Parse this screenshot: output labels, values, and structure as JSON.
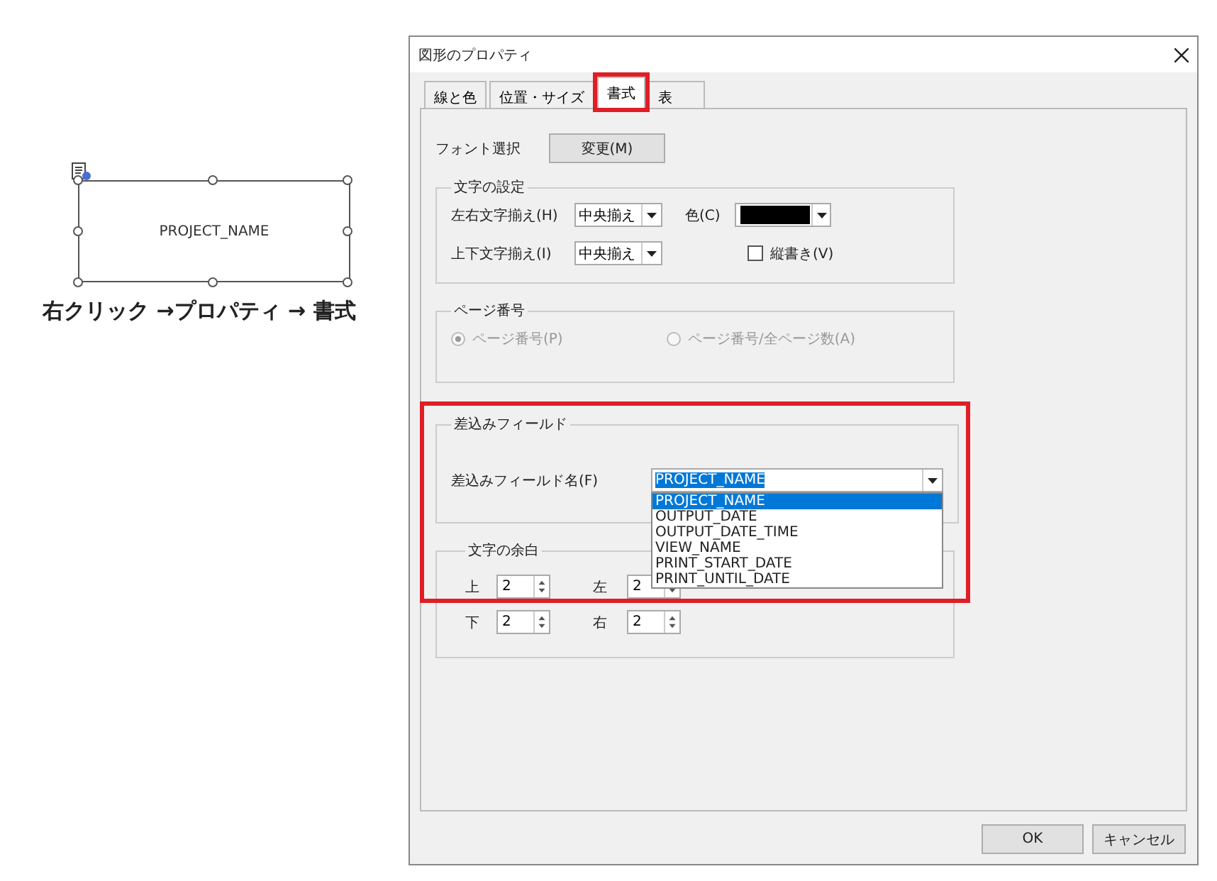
{
  "annotation": {
    "shape_text": "PROJECT_NAME",
    "caption": "右クリック →プロパティ → 書式"
  },
  "dialog": {
    "title": "図形のプロパティ",
    "tabs": [
      {
        "label": "線と色",
        "selected": false,
        "highlighted": false
      },
      {
        "label": "位置・サイズ",
        "selected": false,
        "highlighted": false
      },
      {
        "label": "書式",
        "selected": true,
        "highlighted": true
      },
      {
        "label": "表",
        "selected": false,
        "highlighted": false
      }
    ],
    "font": {
      "label": "フォント選択",
      "button": "変更(M)"
    },
    "text_settings": {
      "title": "文字の設定",
      "h_align": {
        "label": "左右文字揃え(H)",
        "value": "中央揃え"
      },
      "v_align": {
        "label": "上下文字揃え(I)",
        "value": "中央揃え"
      },
      "color": {
        "label": "色(C)",
        "color": "#000000"
      },
      "vertical": {
        "label": "縦書き(V)",
        "checked": false
      }
    },
    "page_number": {
      "title": "ページ番号",
      "disabled": true,
      "options": [
        {
          "label": "ページ番号(P)",
          "selected": true
        },
        {
          "label": "ページ番号/全ページ数(A)",
          "selected": false
        }
      ]
    },
    "merge_field": {
      "title": "差込みフィールド",
      "highlighted": true,
      "label": "差込みフィールド名(F)",
      "value": "PROJECT_NAME",
      "expanded": true,
      "options": [
        {
          "label": "PROJECT_NAME",
          "selected": true
        },
        {
          "label": "OUTPUT_DATE",
          "selected": false
        },
        {
          "label": "OUTPUT_DATE_TIME",
          "selected": false
        },
        {
          "label": "VIEW_NAME",
          "selected": false
        },
        {
          "label": "PRINT_START_DATE",
          "selected": false
        },
        {
          "label": "PRINT_UNTIL_DATE",
          "selected": false
        }
      ]
    },
    "margins": {
      "title": "文字の余白",
      "fields": [
        {
          "label": "上",
          "value": "2"
        },
        {
          "label": "左",
          "value": "2"
        },
        {
          "label": "下",
          "value": "2"
        },
        {
          "label": "右",
          "value": "2"
        }
      ]
    },
    "buttons": [
      "OK",
      "キャンセル"
    ]
  }
}
